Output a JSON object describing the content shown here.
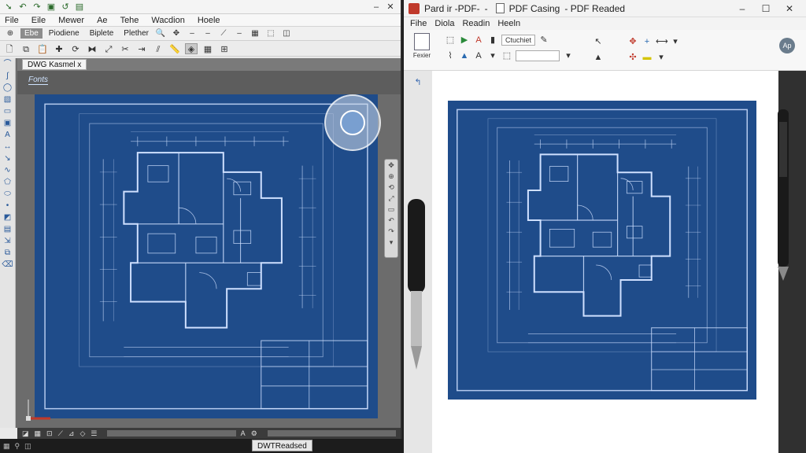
{
  "left_window": {
    "menu": [
      "File",
      "Eile",
      "Mewer",
      "Ae",
      "Tehe",
      "Wacdion",
      "Hoele"
    ],
    "ribbon_tabs": [
      "Ebe",
      "Piodiene",
      "Biplete",
      "Plether"
    ],
    "active_tab": "Ebe",
    "doc_tab_label": "DWG Kasmel",
    "doc_tab_close": "x",
    "model_label": "Fonts",
    "status_item": "DWTReadsed"
  },
  "right_window": {
    "title_left": "Pard ir -PDF-",
    "title_sep": "-",
    "title_doc": "PDF Casing",
    "title_tail": "- PDF Readed",
    "menu": [
      "Fihe",
      "Diola",
      "Readin",
      "Heeln"
    ],
    "big_button_label": "Fexier",
    "combo1": "Ctuchiet",
    "avatar_text": "Ap"
  },
  "colors": {
    "blueprint": "#1f4c8a",
    "line": "#cfe0ff",
    "accent_red": "#c0392b"
  }
}
